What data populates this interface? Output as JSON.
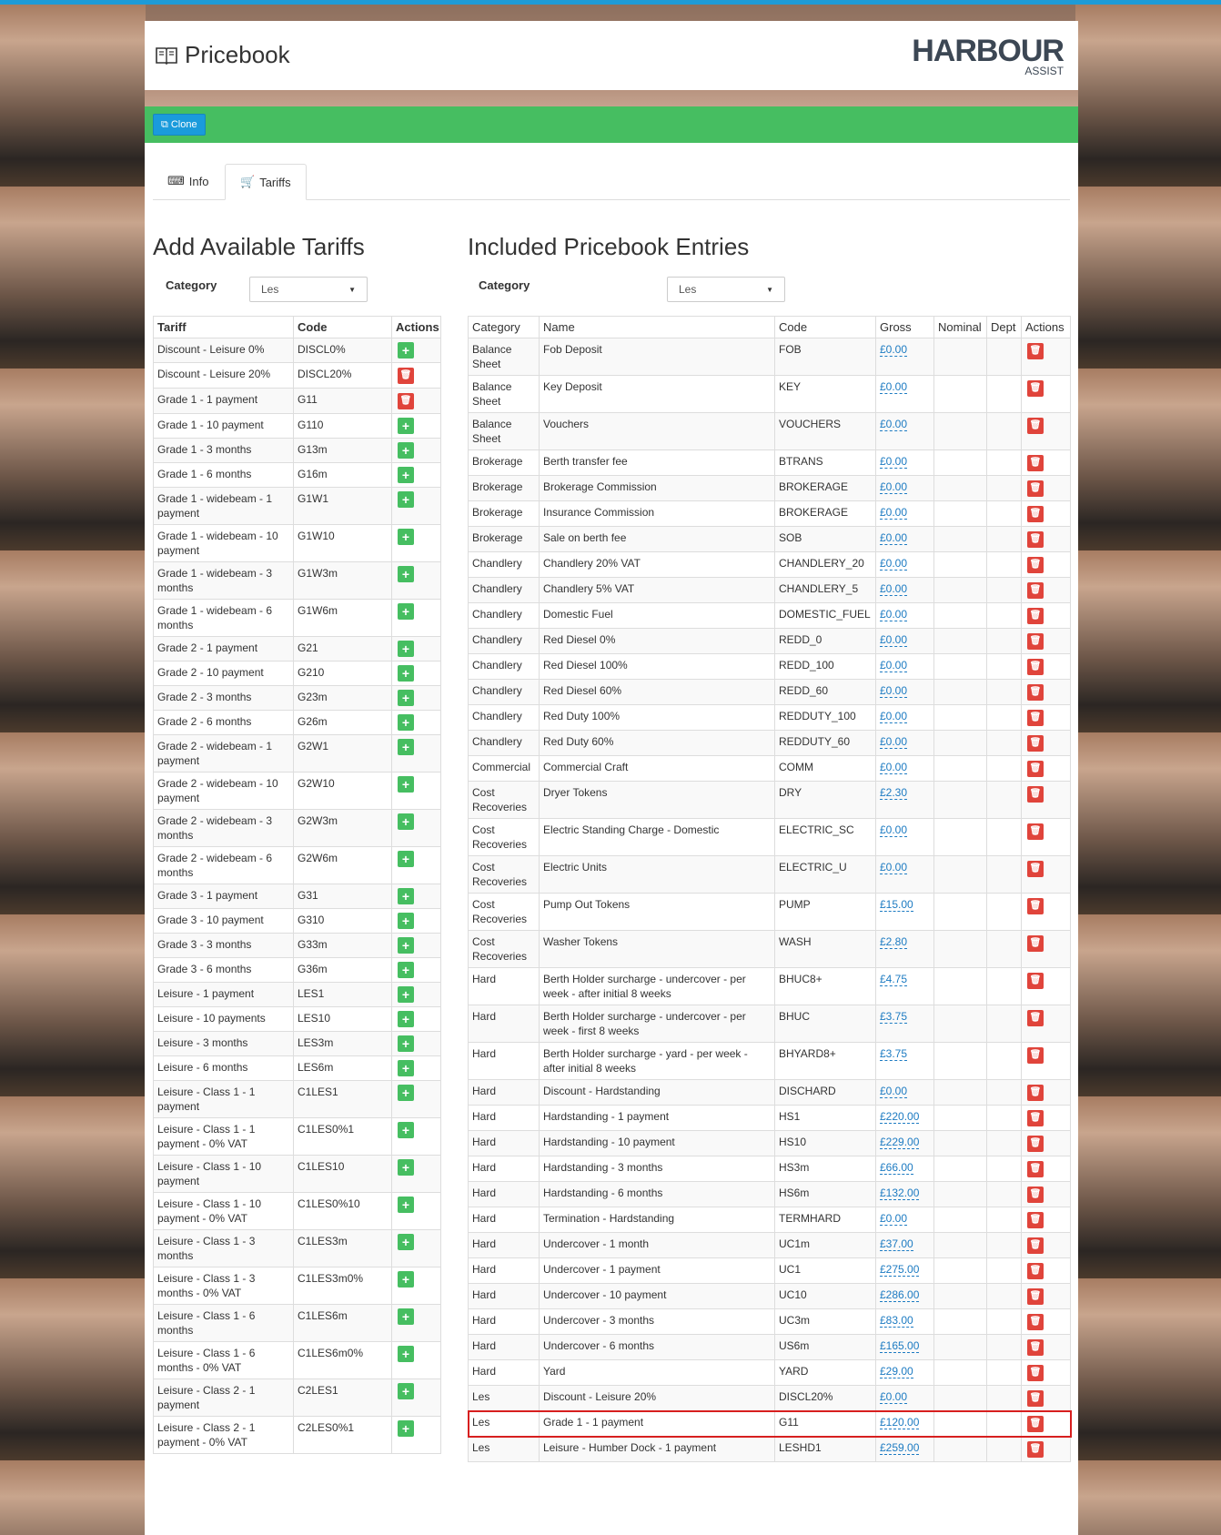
{
  "header": {
    "title": "Pricebook",
    "logo_brand": "HARBOUR",
    "logo_sub": "ASSIST"
  },
  "toolbar": {
    "clone_label": "Clone"
  },
  "tabs": [
    {
      "label": "Info"
    },
    {
      "label": "Tariffs"
    }
  ],
  "left": {
    "heading": "Add Available Tariffs",
    "category_label": "Category",
    "category_value": "Les",
    "columns": [
      "Tariff",
      "Code",
      "Actions"
    ],
    "rows": [
      {
        "tariff": "Discount - Leisure 0%",
        "code": "DISCL0%",
        "action": "add"
      },
      {
        "tariff": "Discount - Leisure 20%",
        "code": "DISCL20%",
        "action": "delete"
      },
      {
        "tariff": "Grade 1 - 1 payment",
        "code": "G11",
        "action": "delete"
      },
      {
        "tariff": "Grade 1 - 10 payment",
        "code": "G110",
        "action": "add"
      },
      {
        "tariff": "Grade 1 - 3 months",
        "code": "G13m",
        "action": "add"
      },
      {
        "tariff": "Grade 1 - 6 months",
        "code": "G16m",
        "action": "add"
      },
      {
        "tariff": "Grade 1 - widebeam - 1 payment",
        "code": "G1W1",
        "action": "add"
      },
      {
        "tariff": "Grade 1 - widebeam - 10 payment",
        "code": "G1W10",
        "action": "add"
      },
      {
        "tariff": "Grade 1 - widebeam - 3 months",
        "code": "G1W3m",
        "action": "add"
      },
      {
        "tariff": "Grade 1 - widebeam - 6 months",
        "code": "G1W6m",
        "action": "add"
      },
      {
        "tariff": "Grade 2 - 1 payment",
        "code": "G21",
        "action": "add"
      },
      {
        "tariff": "Grade 2 - 10 payment",
        "code": "G210",
        "action": "add"
      },
      {
        "tariff": "Grade 2 - 3 months",
        "code": "G23m",
        "action": "add"
      },
      {
        "tariff": "Grade 2 - 6 months",
        "code": "G26m",
        "action": "add"
      },
      {
        "tariff": "Grade 2 - widebeam - 1 payment",
        "code": "G2W1",
        "action": "add"
      },
      {
        "tariff": "Grade 2 - widebeam - 10 payment",
        "code": "G2W10",
        "action": "add"
      },
      {
        "tariff": "Grade 2 - widebeam - 3 months",
        "code": "G2W3m",
        "action": "add"
      },
      {
        "tariff": "Grade 2 - widebeam - 6 months",
        "code": "G2W6m",
        "action": "add"
      },
      {
        "tariff": "Grade 3 - 1 payment",
        "code": "G31",
        "action": "add"
      },
      {
        "tariff": "Grade 3 - 10 payment",
        "code": "G310",
        "action": "add"
      },
      {
        "tariff": "Grade 3 - 3 months",
        "code": "G33m",
        "action": "add"
      },
      {
        "tariff": "Grade 3 - 6 months",
        "code": "G36m",
        "action": "add"
      },
      {
        "tariff": "Leisure - 1 payment",
        "code": "LES1",
        "action": "add"
      },
      {
        "tariff": "Leisure - 10 payments",
        "code": "LES10",
        "action": "add"
      },
      {
        "tariff": "Leisure - 3 months",
        "code": "LES3m",
        "action": "add"
      },
      {
        "tariff": "Leisure - 6 months",
        "code": "LES6m",
        "action": "add"
      },
      {
        "tariff": "Leisure - Class 1 - 1 payment",
        "code": "C1LES1",
        "action": "add"
      },
      {
        "tariff": "Leisure - Class 1 - 1 payment - 0% VAT",
        "code": "C1LES0%1",
        "action": "add"
      },
      {
        "tariff": "Leisure - Class 1 - 10 payment",
        "code": "C1LES10",
        "action": "add"
      },
      {
        "tariff": "Leisure - Class 1 - 10 payment - 0% VAT",
        "code": "C1LES0%10",
        "action": "add"
      },
      {
        "tariff": "Leisure - Class 1 - 3 months",
        "code": "C1LES3m",
        "action": "add"
      },
      {
        "tariff": "Leisure - Class 1 - 3 months - 0% VAT",
        "code": "C1LES3m0%",
        "action": "add"
      },
      {
        "tariff": "Leisure - Class 1 - 6 months",
        "code": "C1LES6m",
        "action": "add"
      },
      {
        "tariff": "Leisure - Class 1 - 6 months - 0% VAT",
        "code": "C1LES6m0%",
        "action": "add"
      },
      {
        "tariff": "Leisure - Class 2 - 1 payment",
        "code": "C2LES1",
        "action": "add"
      },
      {
        "tariff": "Leisure - Class 2 - 1 payment - 0% VAT",
        "code": "C2LES0%1",
        "action": "add"
      }
    ]
  },
  "right": {
    "heading": "Included Pricebook Entries",
    "category_label": "Category",
    "category_value": "Les",
    "columns": [
      "Category",
      "Name",
      "Code",
      "Gross",
      "Nominal",
      "Dept",
      "Actions"
    ],
    "rows": [
      {
        "category": "Balance Sheet",
        "name": "Fob Deposit",
        "code": "FOB",
        "gross": "£0.00"
      },
      {
        "category": "Balance Sheet",
        "name": "Key Deposit",
        "code": "KEY",
        "gross": "£0.00"
      },
      {
        "category": "Balance Sheet",
        "name": "Vouchers",
        "code": "VOUCHERS",
        "gross": "£0.00"
      },
      {
        "category": "Brokerage",
        "name": "Berth transfer fee",
        "code": "BTRANS",
        "gross": "£0.00"
      },
      {
        "category": "Brokerage",
        "name": "Brokerage Commission",
        "code": "BROKERAGE",
        "gross": "£0.00"
      },
      {
        "category": "Brokerage",
        "name": "Insurance Commission",
        "code": "BROKERAGE",
        "gross": "£0.00"
      },
      {
        "category": "Brokerage",
        "name": "Sale on berth fee",
        "code": "SOB",
        "gross": "£0.00"
      },
      {
        "category": "Chandlery",
        "name": "Chandlery 20% VAT",
        "code": "CHANDLERY_20",
        "gross": "£0.00"
      },
      {
        "category": "Chandlery",
        "name": "Chandlery 5% VAT",
        "code": "CHANDLERY_5",
        "gross": "£0.00"
      },
      {
        "category": "Chandlery",
        "name": "Domestic Fuel",
        "code": "DOMESTIC_FUEL",
        "gross": "£0.00"
      },
      {
        "category": "Chandlery",
        "name": "Red Diesel 0%",
        "code": "REDD_0",
        "gross": "£0.00"
      },
      {
        "category": "Chandlery",
        "name": "Red Diesel 100%",
        "code": "REDD_100",
        "gross": "£0.00"
      },
      {
        "category": "Chandlery",
        "name": "Red Diesel 60%",
        "code": "REDD_60",
        "gross": "£0.00"
      },
      {
        "category": "Chandlery",
        "name": "Red Duty 100%",
        "code": "REDDUTY_100",
        "gross": "£0.00"
      },
      {
        "category": "Chandlery",
        "name": "Red Duty 60%",
        "code": "REDDUTY_60",
        "gross": "£0.00"
      },
      {
        "category": "Commercial",
        "name": "Commercial Craft",
        "code": "COMM",
        "gross": "£0.00"
      },
      {
        "category": "Cost Recoveries",
        "name": "Dryer Tokens",
        "code": "DRY",
        "gross": "£2.30"
      },
      {
        "category": "Cost Recoveries",
        "name": "Electric Standing Charge - Domestic",
        "code": "ELECTRIC_SC",
        "gross": "£0.00"
      },
      {
        "category": "Cost Recoveries",
        "name": "Electric Units",
        "code": "ELECTRIC_U",
        "gross": "£0.00"
      },
      {
        "category": "Cost Recoveries",
        "name": "Pump Out Tokens",
        "code": "PUMP",
        "gross": "£15.00"
      },
      {
        "category": "Cost Recoveries",
        "name": "Washer Tokens",
        "code": "WASH",
        "gross": "£2.80"
      },
      {
        "category": "Hard",
        "name": "Berth Holder surcharge - undercover - per week - after initial 8 weeks",
        "code": "BHUC8+",
        "gross": "£4.75"
      },
      {
        "category": "Hard",
        "name": "Berth Holder surcharge - undercover - per week - first 8 weeks",
        "code": "BHUC",
        "gross": "£3.75"
      },
      {
        "category": "Hard",
        "name": "Berth Holder surcharge - yard - per week - after initial 8 weeks",
        "code": "BHYARD8+",
        "gross": "£3.75"
      },
      {
        "category": "Hard",
        "name": "Discount - Hardstanding",
        "code": "DISCHARD",
        "gross": "£0.00"
      },
      {
        "category": "Hard",
        "name": "Hardstanding - 1 payment",
        "code": "HS1",
        "gross": "£220.00"
      },
      {
        "category": "Hard",
        "name": "Hardstanding - 10 payment",
        "code": "HS10",
        "gross": "£229.00"
      },
      {
        "category": "Hard",
        "name": "Hardstanding - 3 months",
        "code": "HS3m",
        "gross": "£66.00"
      },
      {
        "category": "Hard",
        "name": "Hardstanding - 6 months",
        "code": "HS6m",
        "gross": "£132.00"
      },
      {
        "category": "Hard",
        "name": "Termination - Hardstanding",
        "code": "TERMHARD",
        "gross": "£0.00"
      },
      {
        "category": "Hard",
        "name": "Undercover - 1 month",
        "code": "UC1m",
        "gross": "£37.00"
      },
      {
        "category": "Hard",
        "name": "Undercover - 1 payment",
        "code": "UC1",
        "gross": "£275.00"
      },
      {
        "category": "Hard",
        "name": "Undercover - 10 payment",
        "code": "UC10",
        "gross": "£286.00"
      },
      {
        "category": "Hard",
        "name": "Undercover - 3 months",
        "code": "UC3m",
        "gross": "£83.00"
      },
      {
        "category": "Hard",
        "name": "Undercover - 6 months",
        "code": "US6m",
        "gross": "£165.00"
      },
      {
        "category": "Hard",
        "name": "Yard",
        "code": "YARD",
        "gross": "£29.00"
      },
      {
        "category": "Les",
        "name": "Discount - Leisure 20%",
        "code": "DISCL20%",
        "gross": "£0.00"
      },
      {
        "category": "Les",
        "name": "Grade 1 - 1 payment",
        "code": "G11",
        "gross": "£120.00",
        "highlighted": true
      },
      {
        "category": "Les",
        "name": "Leisure - Humber Dock - 1 payment",
        "code": "LESHD1",
        "gross": "£259.00"
      }
    ]
  },
  "colors": {
    "toolbar": "#46be61",
    "clone_button": "#1a9bdc",
    "add": "#46be61",
    "delete": "#e0443b",
    "highlight": "#d71f1f"
  }
}
